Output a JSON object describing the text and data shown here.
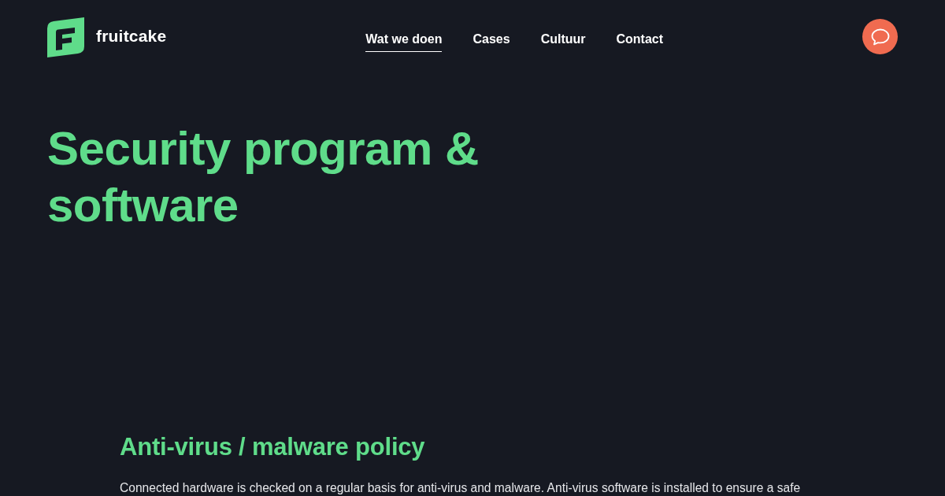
{
  "header": {
    "brand": "fruitcake",
    "nav": [
      {
        "label": "Wat we doen",
        "selected": true
      },
      {
        "label": "Cases",
        "selected": false
      },
      {
        "label": "Cultuur",
        "selected": false
      },
      {
        "label": "Contact",
        "selected": false
      }
    ]
  },
  "hero": {
    "title": "Security program & software"
  },
  "section": {
    "title": "Anti-virus / malware policy",
    "paragraph": "Connected hardware is checked on a regular basis for anti-virus and malware. Anti-virus software is installed to ensure a safe"
  }
}
